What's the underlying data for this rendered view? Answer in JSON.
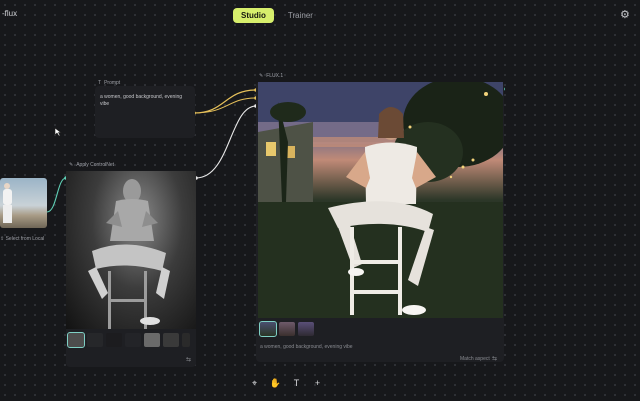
{
  "app": {
    "title": "-flux"
  },
  "tabs": [
    {
      "label": "Studio"
    },
    {
      "label": "Trainer"
    }
  ],
  "icons": {
    "settings": "gear-icon",
    "cursor": "cursor-icon",
    "hand": "hand-icon",
    "text": "text-icon",
    "add": "plus-icon"
  },
  "prompt_node": {
    "label": "Prompt",
    "text": "a women, good background, evening vibe"
  },
  "input_node": {
    "action": "Select from Local"
  },
  "controlnet_node": {
    "label": "Apply ControlNet"
  },
  "flux_node": {
    "label": "FLUX.1",
    "prompt": "a women, good background, evening vibe",
    "aspect_label": "Match aspect"
  },
  "toolbar": {
    "cursor": "⌖",
    "hand": "✋",
    "text": "T",
    "add": "+"
  },
  "colors": {
    "accent": "#d7ef6c",
    "wire": "#e7c15a",
    "wire_white": "#e8e8e8",
    "teal": "#5fd0b6"
  }
}
